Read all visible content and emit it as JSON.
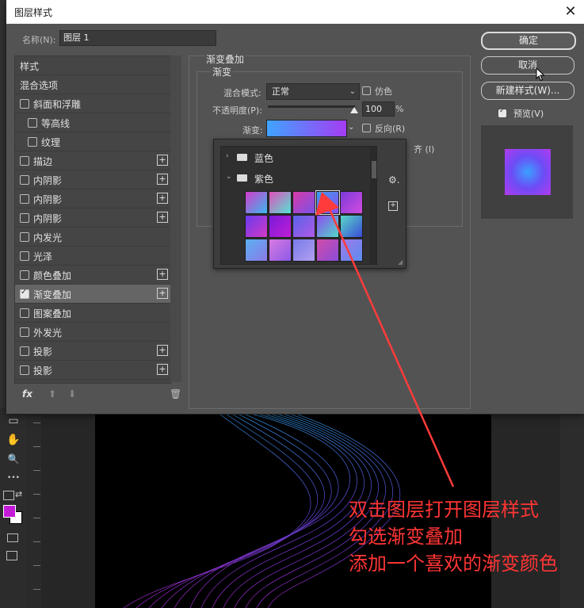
{
  "dialog": {
    "title": "图层样式",
    "close_glyph": "✕",
    "name_label": "名称(N):",
    "name_value": "图层 1"
  },
  "style_list": {
    "items": [
      {
        "label": "样式",
        "has_checkbox": false,
        "checked": false,
        "has_plus": false,
        "indent": 0
      },
      {
        "label": "混合选项",
        "has_checkbox": false,
        "checked": false,
        "has_plus": false,
        "indent": 0
      },
      {
        "label": "斜面和浮雕",
        "has_checkbox": true,
        "checked": false,
        "has_plus": false,
        "indent": 0
      },
      {
        "label": "等高线",
        "has_checkbox": true,
        "checked": false,
        "has_plus": false,
        "indent": 1
      },
      {
        "label": "纹理",
        "has_checkbox": true,
        "checked": false,
        "has_plus": false,
        "indent": 1
      },
      {
        "label": "描边",
        "has_checkbox": true,
        "checked": false,
        "has_plus": true,
        "indent": 0
      },
      {
        "label": "内阴影",
        "has_checkbox": true,
        "checked": false,
        "has_plus": true,
        "indent": 0
      },
      {
        "label": "内阴影",
        "has_checkbox": true,
        "checked": false,
        "has_plus": true,
        "indent": 0
      },
      {
        "label": "内阴影",
        "has_checkbox": true,
        "checked": false,
        "has_plus": true,
        "indent": 0
      },
      {
        "label": "内发光",
        "has_checkbox": true,
        "checked": false,
        "has_plus": false,
        "indent": 0
      },
      {
        "label": "光泽",
        "has_checkbox": true,
        "checked": false,
        "has_plus": false,
        "indent": 0
      },
      {
        "label": "颜色叠加",
        "has_checkbox": true,
        "checked": false,
        "has_plus": true,
        "indent": 0
      },
      {
        "label": "渐变叠加",
        "has_checkbox": true,
        "checked": true,
        "has_plus": true,
        "indent": 0,
        "selected": true
      },
      {
        "label": "图案叠加",
        "has_checkbox": true,
        "checked": false,
        "has_plus": false,
        "indent": 0
      },
      {
        "label": "外发光",
        "has_checkbox": true,
        "checked": false,
        "has_plus": false,
        "indent": 0
      },
      {
        "label": "投影",
        "has_checkbox": true,
        "checked": false,
        "has_plus": true,
        "indent": 0
      },
      {
        "label": "投影",
        "has_checkbox": true,
        "checked": false,
        "has_plus": true,
        "indent": 0
      }
    ],
    "plus_glyph": "+",
    "fx_label": "fx",
    "up_glyph": "⬆",
    "down_glyph": "⬇",
    "trash_glyph": "🗑"
  },
  "gradient_overlay": {
    "group_title": "渐变叠加",
    "subgroup_title": "渐变",
    "blend_mode_label": "混合模式:",
    "blend_mode_value": "正常",
    "dither_label": "仿色",
    "opacity_label": "不透明度(P):",
    "opacity_value": "100",
    "opacity_unit": "%",
    "opacity_fraction": 1.0,
    "gradient_label": "渐变:",
    "reverse_label": "反向(R)",
    "align_label_fragment": "齐 (I)",
    "gradient_colors": [
      "#3fa4ff",
      "#a53cf2"
    ]
  },
  "gradient_picker": {
    "folders": [
      {
        "label": "蓝色",
        "expanded": false,
        "twist": "›"
      },
      {
        "label": "紫色",
        "expanded": true,
        "twist": "⌄"
      }
    ],
    "gear_glyph": "⚙.",
    "add_glyph": "+",
    "swatches": [
      [
        "#d23cc8",
        "#3ab8f0"
      ],
      [
        "#e04fb8",
        "#52e5d6"
      ],
      [
        "#d83aa8",
        "#7a52e8"
      ],
      [
        "#3a9cf0",
        "#8b4cf0"
      ],
      [
        "#7a3ad8",
        "#d44ce0"
      ],
      [
        "#6a3af0",
        "#d23ac4"
      ],
      [
        "#7a1ad8",
        "#c01ed6"
      ],
      [
        "#5a62e8",
        "#b05ae8"
      ],
      [
        "#8c4cf0",
        "#52d8c8"
      ],
      [
        "#5ad8c8",
        "#3a4cd8"
      ],
      [
        "#5ab0f0",
        "#8c7ae8"
      ],
      [
        "#d87ae0",
        "#8c5ae8"
      ],
      [
        "#7a7ae8",
        "#b0a0f0"
      ],
      [
        "#d04ca8",
        "#8c4cd8"
      ],
      [
        "#a07ae8",
        "#5a8cf0"
      ]
    ]
  },
  "buttons": {
    "ok": "确定",
    "cancel": "取消",
    "new_style": "新建样式(W)...",
    "preview_label": "预览(V)",
    "preview_checked": true
  },
  "toolbar": {
    "tools": [
      "▭",
      "✋",
      "🔍",
      "•••"
    ]
  },
  "annotation": {
    "lines": [
      "双击图层打开图层样式",
      "勾选渐变叠加",
      "添加一个喜欢的渐变颜色"
    ],
    "color": "#ff3535"
  }
}
